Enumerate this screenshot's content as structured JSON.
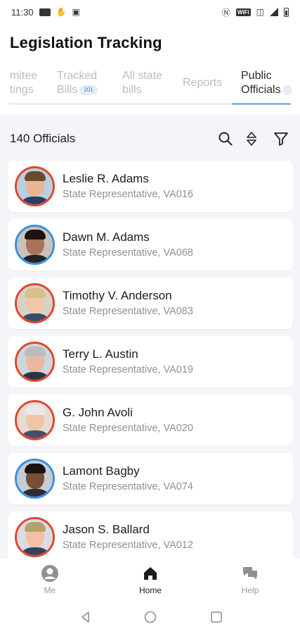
{
  "status_bar": {
    "time": "11:30"
  },
  "app": {
    "title": "Legislation Tracking"
  },
  "tabs": [
    {
      "label": "mitee\ntings",
      "badge": ""
    },
    {
      "label": "Tracked\nBills",
      "badge": "201"
    },
    {
      "label": "All state\nbills",
      "badge": ""
    },
    {
      "label": "Reports",
      "badge": ""
    },
    {
      "label": "Public\nOfficials",
      "badge": ""
    }
  ],
  "list": {
    "count_label": "140 Officials",
    "officials": [
      {
        "name": "Leslie R. Adams",
        "role": "State Representative, VA016",
        "party_color": "#e2452f"
      },
      {
        "name": "Dawn M. Adams",
        "role": "State Representative, VA068",
        "party_color": "#3b8fde"
      },
      {
        "name": "Timothy V. Anderson",
        "role": "State Representative, VA083",
        "party_color": "#e2452f"
      },
      {
        "name": "Terry L. Austin",
        "role": "State Representative, VA019",
        "party_color": "#e2452f"
      },
      {
        "name": "G. John Avoli",
        "role": "State Representative, VA020",
        "party_color": "#e2452f"
      },
      {
        "name": "Lamont Bagby",
        "role": "State Representative, VA074",
        "party_color": "#3b8fde"
      },
      {
        "name": "Jason S. Ballard",
        "role": "State Representative, VA012",
        "party_color": "#e2452f"
      }
    ]
  },
  "icons": {
    "search": "search-icon",
    "sort": "sort-icon",
    "filter": "filter-icon"
  },
  "bottom_nav": {
    "me": "Me",
    "home": "Home",
    "help": "Help"
  }
}
